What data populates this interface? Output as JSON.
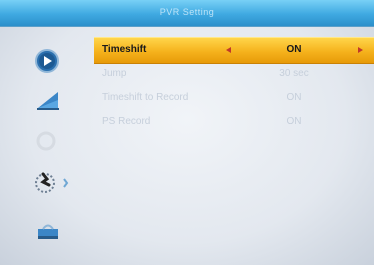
{
  "window": {
    "title": "PVR Setting"
  },
  "sidebar": {
    "icons": [
      {
        "name": "media-play-icon",
        "active": true
      },
      {
        "name": "picture-icon",
        "active": false
      },
      {
        "name": "search-icon",
        "active": false
      },
      {
        "name": "system-settings-icon",
        "active": true
      },
      {
        "name": "tools-icon",
        "active": false
      }
    ]
  },
  "menu": {
    "items": [
      {
        "label": "Timeshift",
        "value": "ON",
        "selected": true
      },
      {
        "label": "Jump",
        "value": "30 sec",
        "selected": false
      },
      {
        "label": "Timeshift to Record",
        "value": "ON",
        "selected": false
      },
      {
        "label": "PS Record",
        "value": "ON",
        "selected": false
      }
    ]
  },
  "colors": {
    "title_bar": "#3fa9e1",
    "highlight": "#f5b21c",
    "arrow": "#c0392b",
    "dim_text": "#c6cfdb"
  }
}
